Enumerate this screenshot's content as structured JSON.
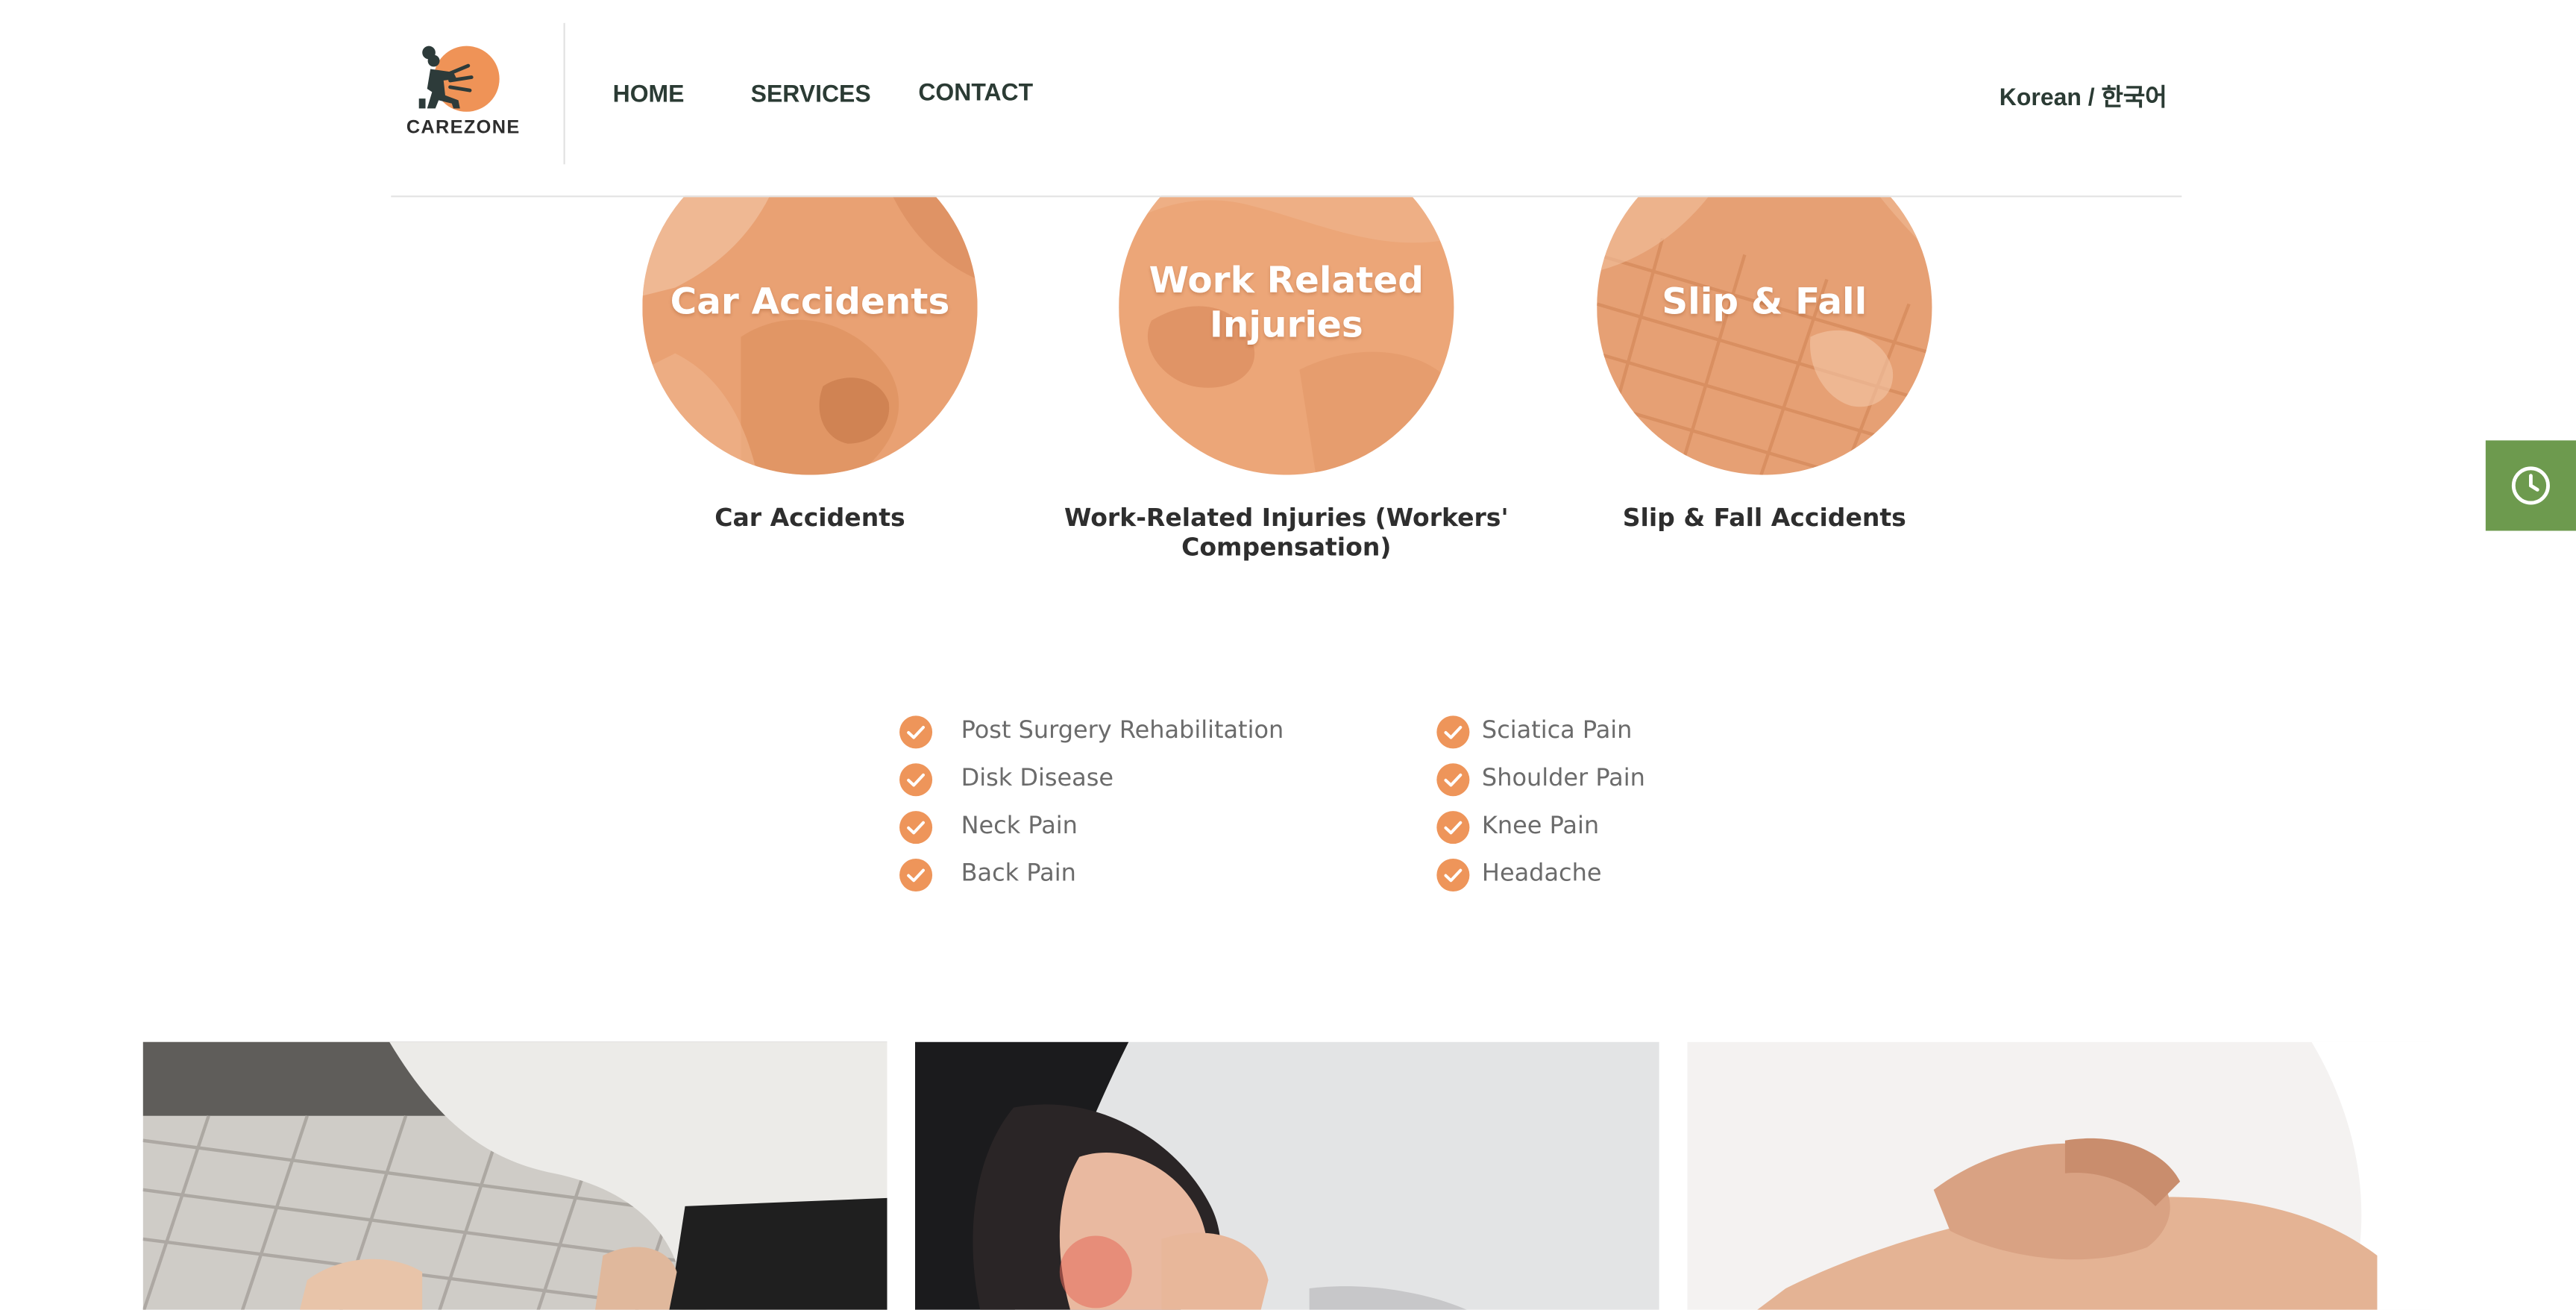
{
  "header": {
    "logo_text": "CAREZONE",
    "nav": [
      "HOME",
      "SERVICES",
      "CONTACT"
    ],
    "language_label": "Korean / 한국어"
  },
  "services": [
    {
      "circle_title": "Car Accidents",
      "caption": "Car Accidents"
    },
    {
      "circle_title": "Work Related Injuries",
      "caption": "Work-Related Injuries (Workers' Compensation)"
    },
    {
      "circle_title": "Slip & Fall",
      "caption": "Slip & Fall Accidents"
    }
  ],
  "conditions": {
    "left": [
      "Post Surgery Rehabilitation",
      "Disk Disease",
      "Neck Pain",
      "Back Pain"
    ],
    "right": [
      "Sciatica Pain",
      "Shoulder Pain",
      "Knee Pain",
      "Headache"
    ]
  },
  "icons": {
    "check": "check-circle-icon",
    "clock": "clock-icon"
  },
  "colors": {
    "accent_orange": "#EE955A",
    "circle_overlay": "#E9A377",
    "clock_tab_green": "#6D9A4E",
    "nav_text": "#2B3B34",
    "body_text": "#6B6B6B"
  }
}
